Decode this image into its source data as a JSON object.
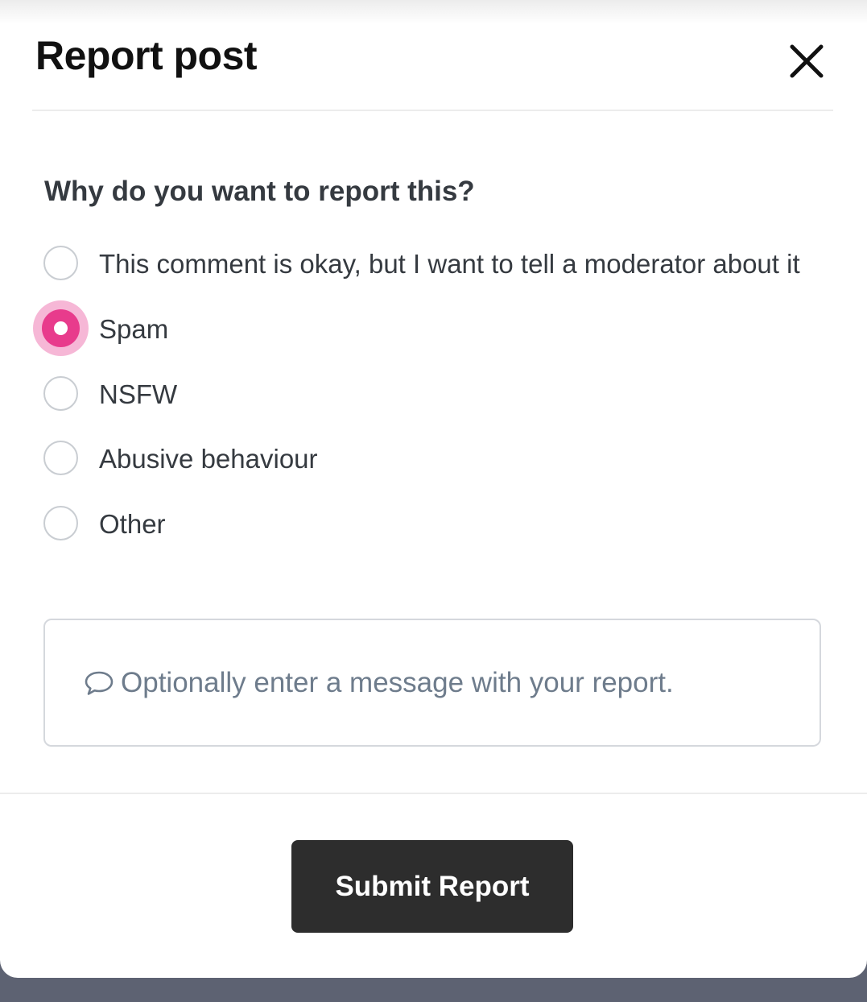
{
  "dialog": {
    "title": "Report post",
    "close_icon": "close-icon"
  },
  "form": {
    "question": "Why do you want to report this?",
    "options": [
      {
        "label": "This comment is okay, but I want to tell a moderator about it",
        "selected": false
      },
      {
        "label": "Spam",
        "selected": true
      },
      {
        "label": "NSFW",
        "selected": false
      },
      {
        "label": "Abusive behaviour",
        "selected": false
      },
      {
        "label": "Other",
        "selected": false
      }
    ],
    "selected_option": "Spam",
    "message": {
      "icon": "speech-bubble-icon",
      "placeholder": "Optionally enter a message with your report.",
      "value": ""
    },
    "submit_label": "Submit Report"
  },
  "colors": {
    "accent": "#e83b8c",
    "accent_halo": "#f6b7d6",
    "submit_background": "#2d2d2d",
    "title_text": "#111111",
    "body_text": "#353a40",
    "placeholder_text": "#6e7c8c"
  }
}
